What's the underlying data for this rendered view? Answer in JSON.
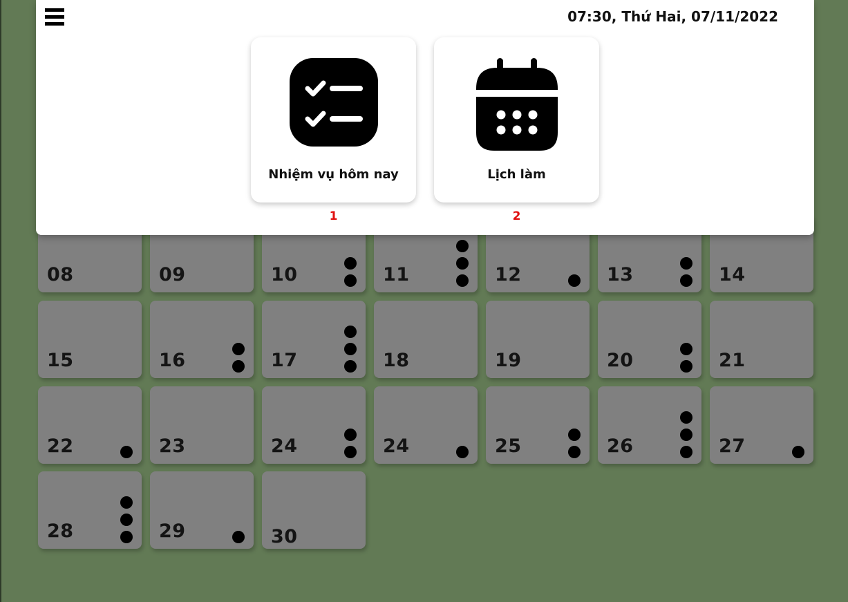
{
  "header": {
    "datetime": "07:30, Thứ Hai, 07/11/2022"
  },
  "cards": [
    {
      "label": "Nhiệm vụ hôm nay",
      "number": "1",
      "icon": "task-checklist-icon"
    },
    {
      "label": "Lịch làm",
      "number": "2",
      "icon": "calendar-icon"
    }
  ],
  "calendar": {
    "days": [
      {
        "label": "08",
        "dots": 0
      },
      {
        "label": "09",
        "dots": 0
      },
      {
        "label": "10",
        "dots": 2
      },
      {
        "label": "11",
        "dots": 3
      },
      {
        "label": "12",
        "dots": 1
      },
      {
        "label": "13",
        "dots": 2
      },
      {
        "label": "14",
        "dots": 0
      },
      {
        "label": "15",
        "dots": 0
      },
      {
        "label": "16",
        "dots": 2
      },
      {
        "label": "17",
        "dots": 3
      },
      {
        "label": "18",
        "dots": 0
      },
      {
        "label": "19",
        "dots": 0
      },
      {
        "label": "20",
        "dots": 2
      },
      {
        "label": "21",
        "dots": 0
      },
      {
        "label": "22",
        "dots": 1
      },
      {
        "label": "23",
        "dots": 0
      },
      {
        "label": "24",
        "dots": 2
      },
      {
        "label": "24",
        "dots": 1
      },
      {
        "label": "25",
        "dots": 2
      },
      {
        "label": "26",
        "dots": 3
      },
      {
        "label": "27",
        "dots": 1
      },
      {
        "label": "28",
        "dots": 3
      },
      {
        "label": "29",
        "dots": 1
      },
      {
        "label": "30",
        "dots": 0
      }
    ]
  },
  "colors": {
    "background": "#627a55",
    "cell": "#808080",
    "card_number": "#e01010"
  }
}
